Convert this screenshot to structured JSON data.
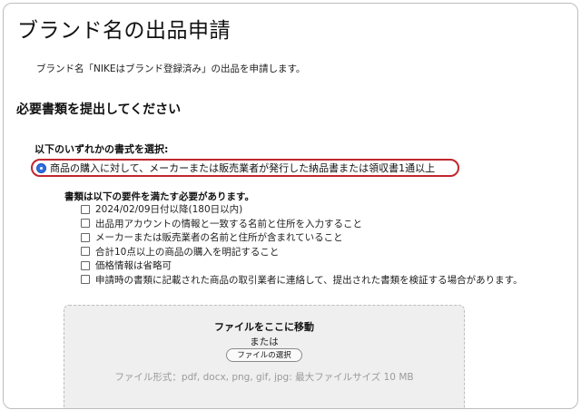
{
  "page": {
    "title": "ブランド名の出品申請",
    "intro": "ブランド名「NIKEはブランド登録済み」の出品を申請します。",
    "section_heading": "必要書類を提出してください"
  },
  "document_choice": {
    "label": "以下のいずれかの書式を選択:",
    "selected_option": "商品の購入に対して、メーカーまたは販売業者が発行した納品書または領収書1通以上",
    "highlight_color": "#c2262e"
  },
  "requirements": {
    "heading": "書類は以下の要件を満たす必要があります。",
    "items": [
      "2024/02/09日付以降(180日以内)",
      "出品用アカウントの情報と一致する名前と住所を入力すること",
      "メーカーまたは販売業者の名前と住所が含まれていること",
      "合計10点以上の商品の購入を明記すること",
      "価格情報は省略可",
      "申請時の書類に記載された商品の取引業者に連絡して、提出された書類を検証する場合があります。"
    ]
  },
  "upload": {
    "title": "ファイルをここに移動",
    "or": "または",
    "button": "ファイルの選択",
    "formats": "ファイル形式：pdf, docx, png, gif, jpg: 最大ファイルサイズ 10 MB"
  }
}
